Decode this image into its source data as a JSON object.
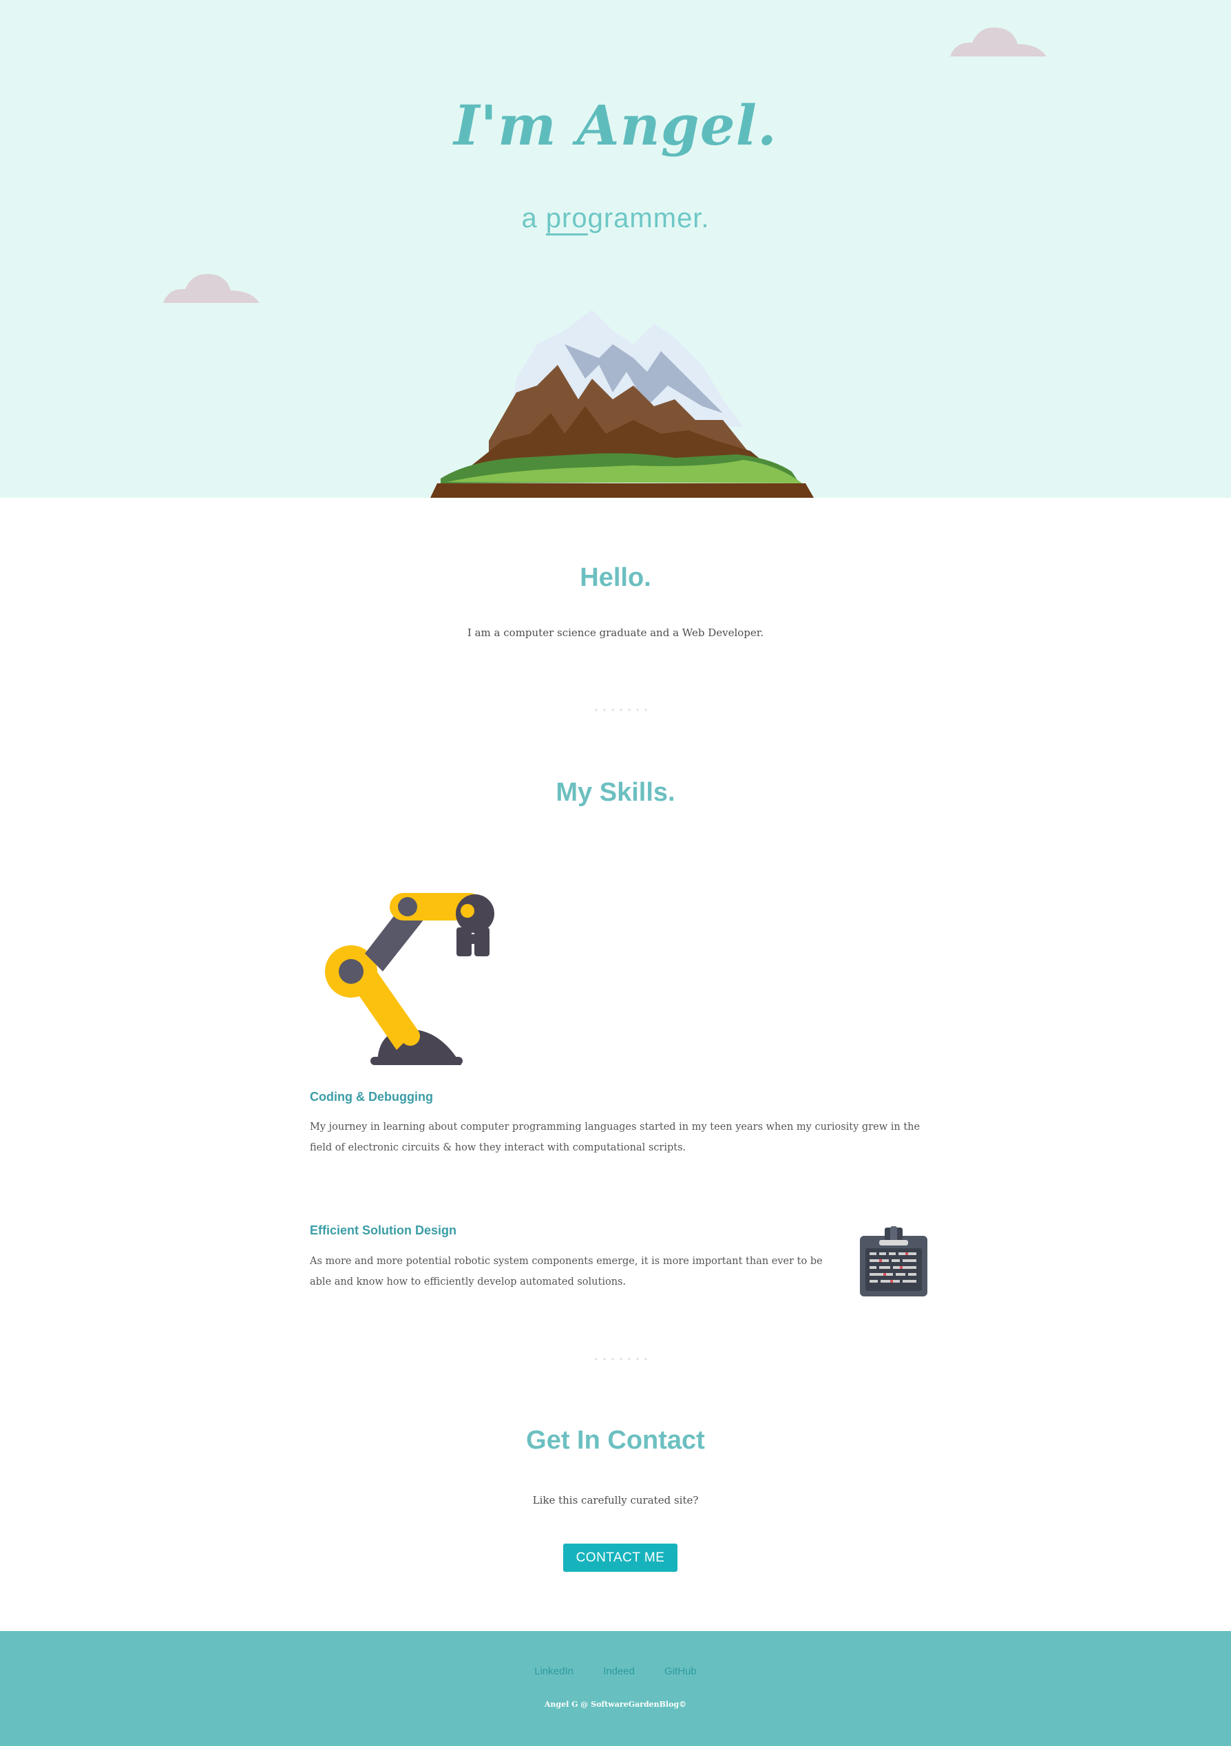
{
  "hero": {
    "title": "I'm Angel.",
    "subtitle_prefix": "a ",
    "subtitle_underlined": "pro",
    "subtitle_rest": "grammer."
  },
  "about": {
    "title": "Hello.",
    "text": "I am a computer science graduate and a Web Developer."
  },
  "skills": {
    "title": "My Skills.",
    "items": [
      {
        "heading": "Coding & Debugging",
        "text_line1": "My journey in learning about computer programming languages started in my teen years when my curiosity grew in the",
        "text_line2": "field of electronic circuits & how they interact with computational scripts."
      },
      {
        "heading": "Efficient Solution Design",
        "text_line1": "As more and more potential robotic system components emerge, it is more important than ever to be",
        "text_line2": "able and know how to efficiently develop automated solutions."
      }
    ]
  },
  "contact": {
    "title": "Get In Contact",
    "text": "Like this carefully curated site?",
    "button_label": "CONTACT ME"
  },
  "footer": {
    "links": [
      "LinkedIn",
      "Indeed",
      "GitHub"
    ],
    "copyright": "Angel G @ SoftwareGardenBlog©"
  },
  "colors": {
    "hero_bg": "#e3f8f4",
    "accent": "#6cbfc0",
    "button": "#17b3bd",
    "footer_bg": "#67c0bf"
  },
  "icons": [
    "cloud-icon",
    "mountain-illustration",
    "robot-arm-icon",
    "id-badge-icon"
  ]
}
